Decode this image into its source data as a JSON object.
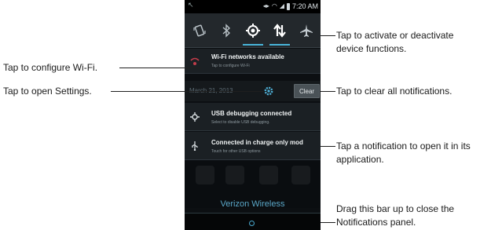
{
  "status_bar": {
    "time": "7:20 AM"
  },
  "quick_toggles": [
    {
      "icon": "auto-rotate-icon",
      "active": false
    },
    {
      "icon": "bluetooth-icon",
      "active": false
    },
    {
      "icon": "gps-icon",
      "active": true
    },
    {
      "icon": "mobile-data-icon",
      "active": true
    },
    {
      "icon": "airplane-mode-icon",
      "active": false
    }
  ],
  "wifi_notification": {
    "title": "Wi-Fi networks available",
    "subtitle": "Tap to configure Wi-Fi"
  },
  "date_row": {
    "date": "March 21, 2013",
    "clear_label": "Clear"
  },
  "notifications": [
    {
      "icon": "usb-debug-icon",
      "title": "USB debugging connected",
      "subtitle": "Select to disable USB debugging."
    },
    {
      "icon": "usb-icon",
      "title": "Connected in charge only mod",
      "subtitle": "Touch for other USB options"
    }
  ],
  "carrier": "Verizon Wireless",
  "callouts": {
    "device_functions": [
      "Tap to activate or deactivate",
      "device functions."
    ],
    "configure_wifi": "Tap to configure Wi-Fi.",
    "open_settings": "Tap to open Settings.",
    "clear_all": "Tap to clear all notifications.",
    "open_notification": [
      "Tap a notification to open it in its",
      "application."
    ],
    "close_panel": [
      "Drag this bar up to close the",
      "Notifications panel."
    ]
  },
  "colors": {
    "accent": "#48b3d8",
    "panel": "#1b2024",
    "callout_line": "#1f1f1f"
  }
}
